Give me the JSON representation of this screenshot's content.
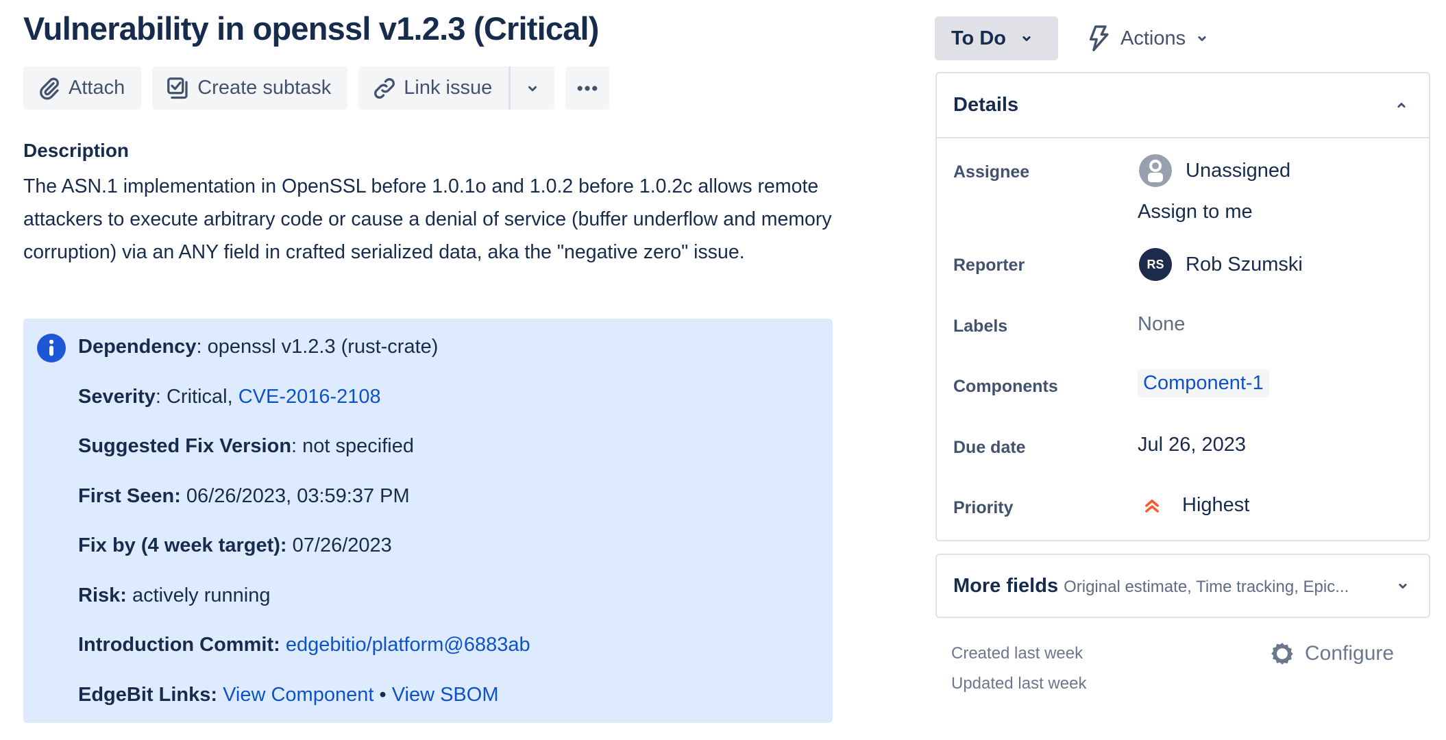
{
  "issue": {
    "title": "Vulnerability in openssl v1.2.3 (Critical)"
  },
  "toolbar": {
    "attach_label": "Attach",
    "create_subtask_label": "Create subtask",
    "link_issue_label": "Link issue",
    "icons": {
      "attach": "paperclip-icon",
      "create_subtask": "subtask-icon",
      "link_issue": "link-icon",
      "link_dropdown": "chevron-down-icon",
      "more": "more-horizontal-icon"
    }
  },
  "description": {
    "label": "Description",
    "text": "The ASN.1 implementation in OpenSSL before 1.0.1o and 1.0.2 before 1.0.2c allows remote attackers to execute arbitrary code or cause a denial of service (buffer underflow and memory corruption) via an ANY field in crafted serialized data, aka the \"negative zero\" issue."
  },
  "info_panel": {
    "icon": "info-icon",
    "colors": {
      "background": "#deebff",
      "icon": "#0c52cc"
    },
    "dependency": {
      "label": "Dependency",
      "sep": ":",
      "value": " openssl v1.2.3 (rust-crate)"
    },
    "severity": {
      "label": "Severity",
      "sep": ":",
      "value": " Critical, ",
      "cve_link": "CVE-2016-2108"
    },
    "suggested_fix": {
      "label": "Suggested Fix Version",
      "sep": ":",
      "value": " not specified"
    },
    "first_seen": {
      "label": "First Seen:",
      "value": " 06/26/2023, 03:59:37 PM"
    },
    "fix_by": {
      "label": "Fix by (4 week target):",
      "value": " 07/26/2023"
    },
    "risk": {
      "label": "Risk:",
      "value": " actively running"
    },
    "intro_commit": {
      "label": "Introduction Commit:",
      "link": "edgebitio/platform@6883ab"
    },
    "edgebit_links": {
      "label": "EdgeBit Links:",
      "view_component": "View Component",
      "bullet": " • ",
      "view_sbom": "View SBOM"
    }
  },
  "status": {
    "label": "To Do",
    "actions_label": "Actions"
  },
  "details": {
    "header": "Details",
    "fields": {
      "assignee": {
        "label": "Assignee",
        "value": "Unassigned",
        "assign_to_me": "Assign to me"
      },
      "reporter": {
        "label": "Reporter",
        "value": "Rob Szumski",
        "initials": "RS"
      },
      "labels": {
        "label": "Labels",
        "value": "None"
      },
      "components": {
        "label": "Components",
        "value": "Component-1"
      },
      "due_date": {
        "label": "Due date",
        "value": "Jul 26, 2023"
      },
      "priority": {
        "label": "Priority",
        "value": "Highest",
        "color": "#ff5630"
      }
    }
  },
  "more_fields": {
    "label": "More fields",
    "summary": "Original estimate, Time tracking, Epic..."
  },
  "footer": {
    "created": "Created last week",
    "updated": "Updated last week",
    "configure_label": "Configure"
  }
}
